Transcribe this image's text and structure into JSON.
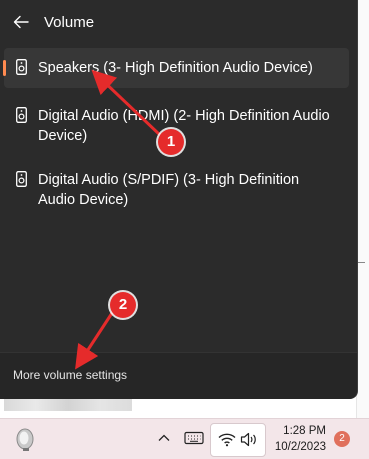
{
  "flyout": {
    "title": "Volume",
    "devices": [
      {
        "label": "Speakers (3- High Definition Audio Device)",
        "selected": true
      },
      {
        "label": "Digital Audio (HDMI) (2- High Definition Audio Device)",
        "selected": false
      },
      {
        "label": "Digital Audio (S/PDIF) (3- High Definition Audio Device)",
        "selected": false
      }
    ],
    "footer_link": "More volume settings"
  },
  "taskbar": {
    "time": "1:28 PM",
    "date": "10/2/2023",
    "notification_count": "2",
    "icons": [
      "chevron-up-icon",
      "keyboard-icon",
      "wifi-icon",
      "speaker-icon"
    ]
  },
  "annotations": {
    "marker_1": "1",
    "marker_2": "2",
    "color": "#e52b2b"
  },
  "colors": {
    "accent": "#ff8a50",
    "flyout_bg": "#2b2b2b",
    "taskbar_bg": "#f3e6e9"
  }
}
